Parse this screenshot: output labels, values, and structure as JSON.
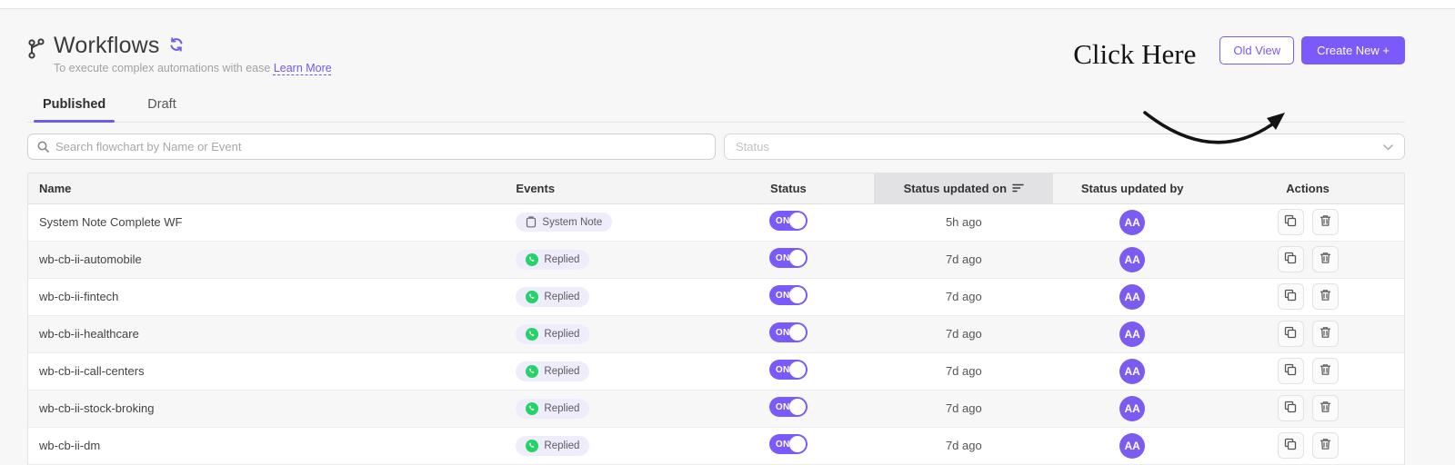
{
  "colors": {
    "accent": "#7a5af8",
    "accent_link": "#6d5ce8",
    "whatsapp_green": "#25d366",
    "page_bg": "#f7f7f8",
    "sorted_header_bg": "#e2e2e5",
    "avatar_bg": "#7c5cf0"
  },
  "header": {
    "title": "Workflows",
    "subtitle": "To execute complex automations with ease",
    "learn_more_label": "Learn More",
    "annotation_text": "Click Here",
    "old_view_label": "Old View",
    "create_new_label": "Create New +"
  },
  "tabs": [
    {
      "label": "Published",
      "active": true
    },
    {
      "label": "Draft",
      "active": false
    }
  ],
  "filters": {
    "search_placeholder": "Search flowchart by Name or Event",
    "search_value": "",
    "status_placeholder": "Status"
  },
  "table": {
    "columns": [
      {
        "label": "Name",
        "sorted": false
      },
      {
        "label": "Events",
        "sorted": false
      },
      {
        "label": "Status",
        "sorted": false
      },
      {
        "label": "Status updated on",
        "sorted": true
      },
      {
        "label": "Status updated by",
        "sorted": false
      },
      {
        "label": "Actions",
        "sorted": false
      }
    ],
    "rows": [
      {
        "name": "System Note Complete WF",
        "event": "System Note",
        "event_icon": "system-note-icon",
        "status": "ON",
        "updated_on": "5h ago",
        "updated_by": "AA"
      },
      {
        "name": "wb-cb-ii-automobile",
        "event": "Replied",
        "event_icon": "whatsapp-icon",
        "status": "ON",
        "updated_on": "7d ago",
        "updated_by": "AA"
      },
      {
        "name": "wb-cb-ii-fintech",
        "event": "Replied",
        "event_icon": "whatsapp-icon",
        "status": "ON",
        "updated_on": "7d ago",
        "updated_by": "AA"
      },
      {
        "name": "wb-cb-ii-healthcare",
        "event": "Replied",
        "event_icon": "whatsapp-icon",
        "status": "ON",
        "updated_on": "7d ago",
        "updated_by": "AA"
      },
      {
        "name": "wb-cb-ii-call-centers",
        "event": "Replied",
        "event_icon": "whatsapp-icon",
        "status": "ON",
        "updated_on": "7d ago",
        "updated_by": "AA"
      },
      {
        "name": "wb-cb-ii-stock-broking",
        "event": "Replied",
        "event_icon": "whatsapp-icon",
        "status": "ON",
        "updated_on": "7d ago",
        "updated_by": "AA"
      },
      {
        "name": "wb-cb-ii-dm",
        "event": "Replied",
        "event_icon": "whatsapp-icon",
        "status": "ON",
        "updated_on": "7d ago",
        "updated_by": "AA"
      }
    ]
  }
}
